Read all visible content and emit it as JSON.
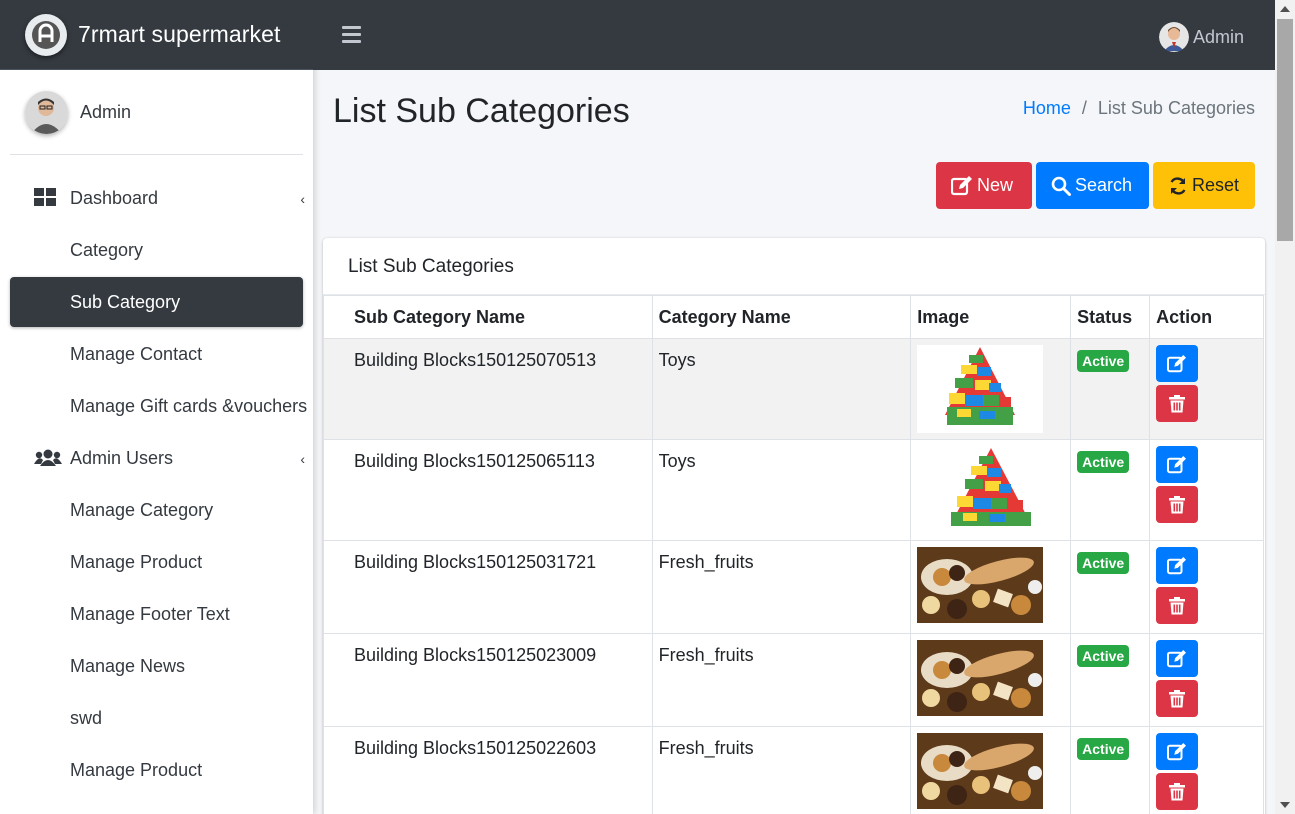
{
  "brand": {
    "name": "7rmart supermarket"
  },
  "user": {
    "name": "Admin"
  },
  "topbar": {
    "user_name": "Admin"
  },
  "sidebar": {
    "items": [
      {
        "label": "Dashboard",
        "icon": "dashboard-icon",
        "caret": "‹"
      },
      {
        "label": "Category"
      },
      {
        "label": "Sub Category",
        "active": true
      },
      {
        "label": "Manage Contact"
      },
      {
        "label": "Manage Gift cards &vouchers"
      },
      {
        "label": "Admin Users",
        "icon": "users-icon",
        "caret": "‹"
      },
      {
        "label": "Manage Category"
      },
      {
        "label": "Manage Product"
      },
      {
        "label": "Manage Footer Text"
      },
      {
        "label": "Manage News"
      },
      {
        "label": "swd"
      },
      {
        "label": "Manage Product"
      }
    ]
  },
  "page": {
    "title": "List Sub Categories",
    "breadcrumb": {
      "home": "Home",
      "separator": "/",
      "current": "List Sub Categories"
    }
  },
  "actions": {
    "new": "New",
    "search": "Search",
    "reset": "Reset"
  },
  "card": {
    "title": "List Sub Categories",
    "columns": [
      "Sub Category Name",
      "Category Name",
      "Image",
      "Status",
      "Action"
    ],
    "rows": [
      {
        "name": "Building Blocks150125070513",
        "category": "Toys",
        "image": "lego-tree",
        "status": "Active"
      },
      {
        "name": "Building Blocks150125065113",
        "category": "Toys",
        "image": "lego-tree",
        "status": "Active"
      },
      {
        "name": "Building Blocks150125031721",
        "category": "Fresh_fruits",
        "image": "cookies",
        "status": "Active"
      },
      {
        "name": "Building Blocks150125023009",
        "category": "Fresh_fruits",
        "image": "cookies",
        "status": "Active"
      },
      {
        "name": "Building Blocks150125022603",
        "category": "Fresh_fruits",
        "image": "cookies",
        "status": "Active"
      }
    ]
  },
  "colors": {
    "sidebar_dark": "#343a40",
    "primary": "#007bff",
    "danger": "#dc3545",
    "warning": "#ffc107",
    "success": "#28a745"
  }
}
